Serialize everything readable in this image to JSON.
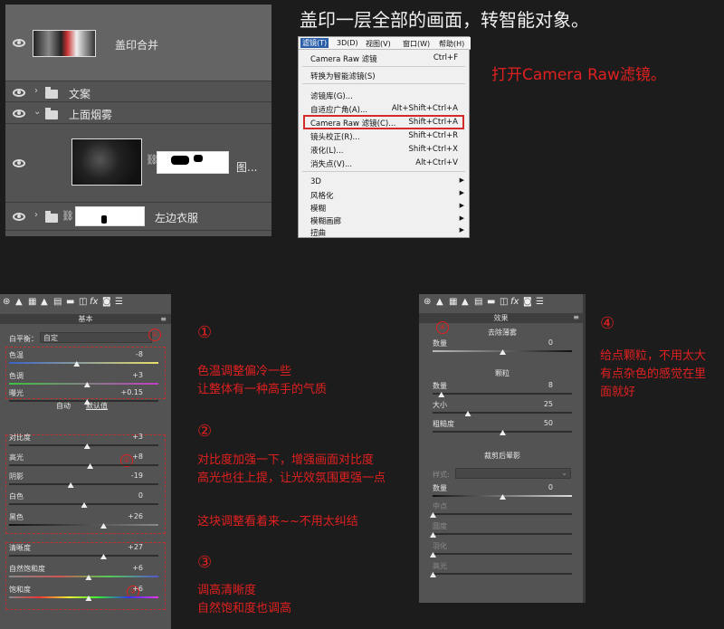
{
  "layers": {
    "items": [
      {
        "name": "盖印合并"
      },
      {
        "name": "文案"
      },
      {
        "name": "上面烟雾"
      },
      {
        "name": "图..."
      },
      {
        "name": "左边衣服"
      }
    ]
  },
  "menu": {
    "bar": [
      "滤镜(T)",
      "3D(D)",
      "视图(V)",
      "窗口(W)",
      "帮助(H)"
    ],
    "items": [
      {
        "label": "Camera Raw 滤镜",
        "shortcut": "Ctrl+F"
      },
      {
        "label": "转换为智能滤镜(S)",
        "shortcut": ""
      },
      {
        "label": "滤镜库(G)...",
        "shortcut": ""
      },
      {
        "label": "自适应广角(A)...",
        "shortcut": "Alt+Shift+Ctrl+A"
      },
      {
        "label": "Camera Raw 滤镜(C)...",
        "shortcut": "Shift+Ctrl+A"
      },
      {
        "label": "镜头校正(R)...",
        "shortcut": "Shift+Ctrl+R"
      },
      {
        "label": "液化(L)...",
        "shortcut": "Shift+Ctrl+X"
      },
      {
        "label": "消失点(V)...",
        "shortcut": "Alt+Ctrl+V"
      },
      {
        "label": "3D",
        "shortcut": ""
      },
      {
        "label": "风格化",
        "shortcut": ""
      },
      {
        "label": "模糊",
        "shortcut": ""
      },
      {
        "label": "模糊画廊",
        "shortcut": ""
      },
      {
        "label": "扭曲",
        "shortcut": ""
      }
    ]
  },
  "texts": {
    "title": "盖印一层全部的画面，转智能对象。",
    "open_acr": "打开Camera Raw滤镜。",
    "n1": "①",
    "note1": [
      "色温调整偏冷一些",
      "让整体有一种高手的气质"
    ],
    "n2": "②",
    "note2": [
      "对比度加强一下，增强画面对比度",
      "高光也往上提，让光效氛围更强一点"
    ],
    "note2b": "这块调整看着来~~不用太纠结",
    "n3": "③",
    "note3": [
      "调高清晰度",
      "自然饱和度也调高"
    ],
    "n4": "④",
    "note4": [
      "给点颗粒，不用太大",
      "有点杂色的感觉在里",
      "面就好"
    ]
  },
  "basic_panel": {
    "title": "基本",
    "wb_label": "白平衡：",
    "wb_value": "自定",
    "auto": "自动",
    "default": "默认值",
    "circle1": "①",
    "circle2": "②",
    "circle3": "③",
    "sliders": [
      {
        "label": "色温",
        "value": "-8",
        "pos": 0.45
      },
      {
        "label": "色调",
        "value": "+3",
        "pos": 0.52
      },
      {
        "label": "曝光",
        "value": "+0.15",
        "pos": 0.52
      },
      {
        "label": "对比度",
        "value": "+3",
        "pos": 0.52
      },
      {
        "label": "高光",
        "value": "+8",
        "pos": 0.54
      },
      {
        "label": "阴影",
        "value": "-19",
        "pos": 0.41
      },
      {
        "label": "白色",
        "value": "0",
        "pos": 0.5
      },
      {
        "label": "黑色",
        "value": "+26",
        "pos": 0.63
      },
      {
        "label": "清晰度",
        "value": "+27",
        "pos": 0.63
      },
      {
        "label": "自然饱和度",
        "value": "+6",
        "pos": 0.53
      },
      {
        "label": "饱和度",
        "value": "+6",
        "pos": 0.53
      }
    ]
  },
  "fx_panel": {
    "title": "效果",
    "circle4": "④",
    "dehaze_title": "去除薄雾",
    "grain_title": "颗粒",
    "vignette_title": "裁剪后晕影",
    "style_label": "样式:",
    "sliders": [
      {
        "label": "数量",
        "value": "0",
        "pos": 0.5
      },
      {
        "label": "数量",
        "value": "8",
        "pos": 0.06
      },
      {
        "label": "大小",
        "value": "25",
        "pos": 0.25
      },
      {
        "label": "粗糙度",
        "value": "50",
        "pos": 0.5
      },
      {
        "label": "数量",
        "value": "0",
        "pos": 0.5
      },
      {
        "label": "中点",
        "value": "",
        "pos": 0
      },
      {
        "label": "圆度",
        "value": "",
        "pos": 0
      },
      {
        "label": "羽化",
        "value": "",
        "pos": 0
      },
      {
        "label": "高光",
        "value": "",
        "pos": 0
      }
    ]
  }
}
